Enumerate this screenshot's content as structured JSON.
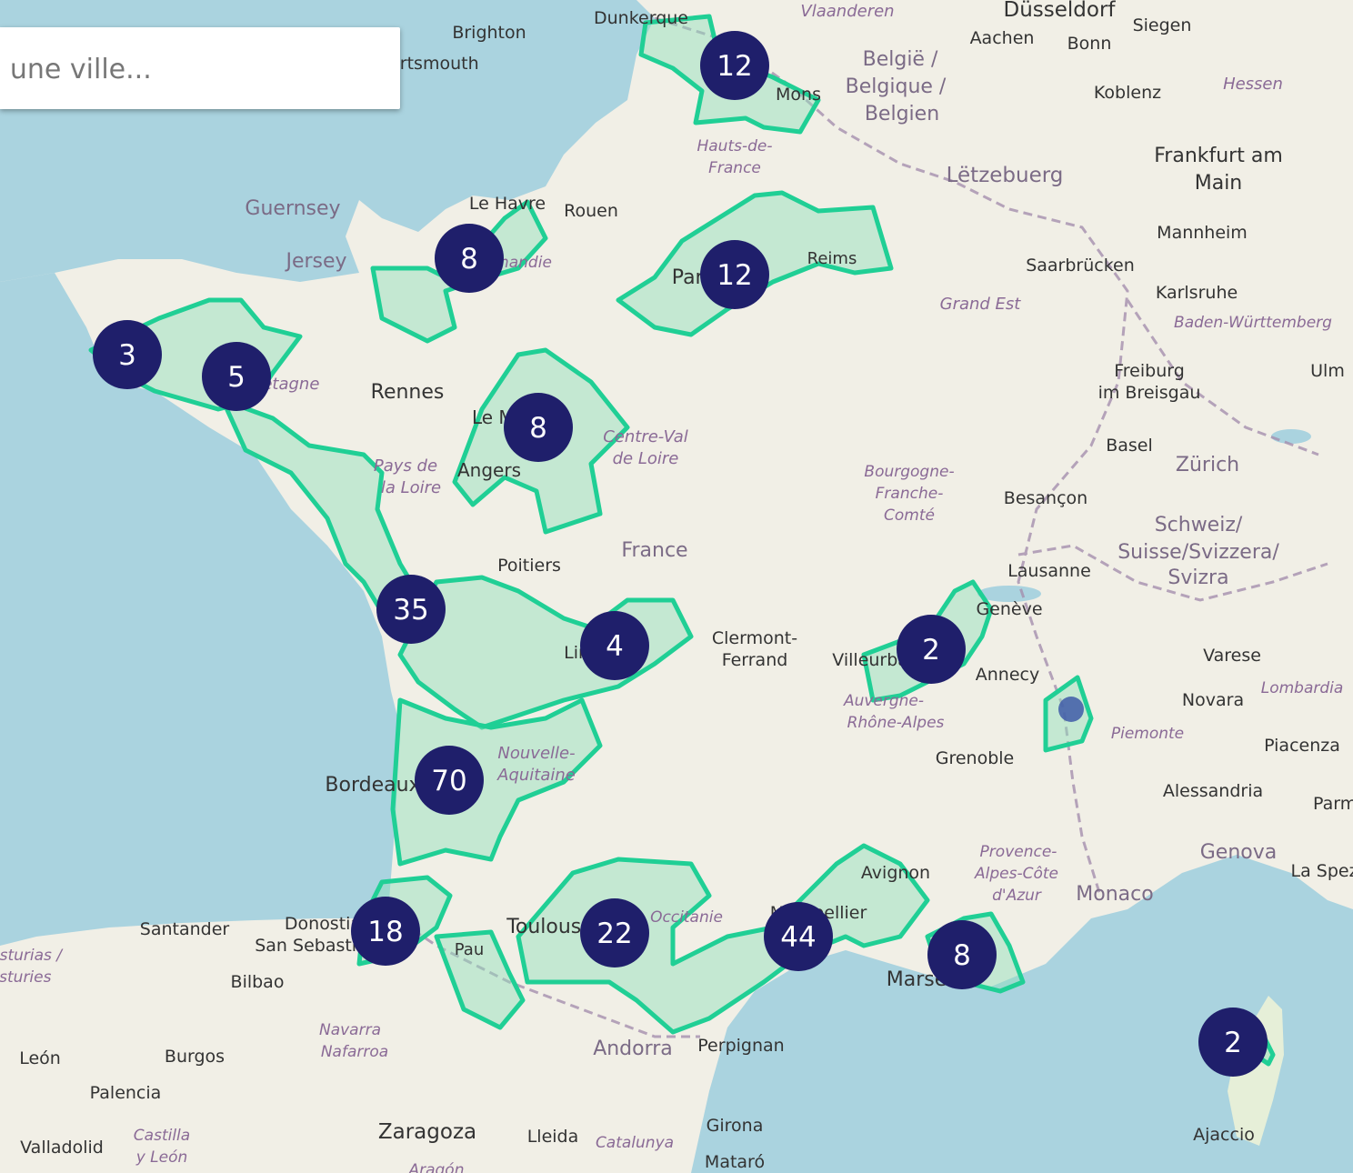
{
  "search": {
    "placeholder": "ou une ville..."
  },
  "colors": {
    "water": "#aad3df",
    "land": "#f1efe6",
    "zone_stroke": "#20cf95",
    "zone_fill": "#8fe0bb",
    "cluster": "#1f1f6b",
    "dot": "#3f5aa8"
  },
  "clusters": [
    "12",
    "8",
    "12",
    "3",
    "5",
    "8",
    "35",
    "4",
    "2",
    "70",
    "18",
    "22",
    "44",
    "8",
    "2"
  ],
  "places": [
    "Dunkerque",
    "Vlaanderen",
    "Düsseldorf",
    "Siegen",
    "Aachen",
    "Bonn",
    "Brighton",
    "Portsmouth",
    "België /",
    "Belgique /",
    "Belgien",
    "Koblenz",
    "Hessen",
    "Mons",
    "Hauts-de-",
    "France",
    "Frankfurt am",
    "Main",
    "Lëtzebuerg",
    "Guernsey",
    "Le Havre",
    "Rouen",
    "Mannheim",
    "Jersey",
    "Normandie",
    "Paris",
    "Reims",
    "Saarbrücken",
    "Karlsruhe",
    "Grand Est",
    "Baden-Württemberg",
    "Bretagne",
    "Rennes",
    "Freiburg",
    "im Breisgau",
    "Ulm",
    "Le Mans",
    "Centre-Val",
    "de Loire",
    "Basel",
    "Zürich",
    "Pays de",
    "la Loire",
    "Angers",
    "Bourgogne-",
    "Franche-",
    "Comté",
    "Besançon",
    "Schweiz/",
    "Suisse/Svizzera/",
    "Svizra",
    "France",
    "Poitiers",
    "Lausanne",
    "Genève",
    "Clermont-",
    "Ferrand",
    "Limoges",
    "Villeurbanne",
    "Annecy",
    "Varese",
    "Auvergne-",
    "Rhône-Alpes",
    "Novara",
    "Lombardia",
    "Piemonte",
    "Nouvelle-",
    "Aquitaine",
    "Grenoble",
    "Piacenza",
    "Bordeaux",
    "Alessandria",
    "Parma",
    "Genova",
    "Provence-",
    "Alpes-Côte",
    "d'Azur",
    "Avignon",
    "Monaco",
    "La Spezia",
    "Santander",
    "Donostia",
    "San Sebastián",
    "Montpellier",
    "Toulouse",
    "Occitanie",
    "Asturias /",
    "Asturies",
    "Pau",
    "Marseille",
    "Bilbao",
    "Navarra",
    "Nafarroa",
    "Andorra",
    "Perpignan",
    "León",
    "Burgos",
    "Palencia",
    "Castilla",
    "y León",
    "Valladolid",
    "Zaragoza",
    "Lleida",
    "Catalunya",
    "Girona",
    "Mataró",
    "Ajaccio",
    "Aragón"
  ]
}
